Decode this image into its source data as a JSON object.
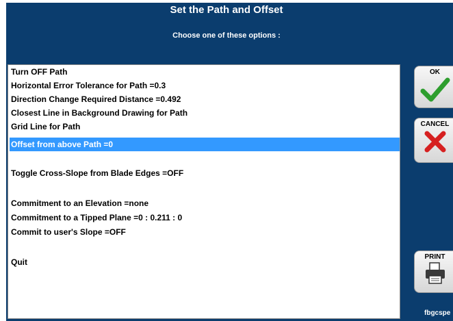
{
  "dialog": {
    "title": "Set the Path and Offset",
    "subtitle": "Choose one of these options :"
  },
  "options": [
    "Turn OFF Path",
    "Horizontal Error Tolerance for Path  =0.3",
    "Direction Change Required Distance  =0.492",
    "Closest Line in Background Drawing for Path",
    "Grid Line for Path",
    "Offset from above Path  =0",
    "Toggle Cross-Slope from Blade Edges   =OFF",
    "Commitment to an Elevation   =none",
    "Commitment to a Tipped Plane =0 : 0.211 : 0",
    "Commit to user's Slope  =OFF",
    "Quit"
  ],
  "selected_option": "Offset from above Path  =0",
  "buttons": {
    "ok_label": "OK",
    "cancel_label": "CANCEL",
    "print_label": "PRINT"
  },
  "icons": {
    "ok": "checkmark-icon",
    "cancel": "x-icon",
    "print": "printer-icon"
  },
  "footer": {
    "text": "fbgcspe"
  },
  "colors": {
    "background": "#0b3d6e",
    "selection": "#3399ff",
    "ok_check": "#2e9e2e",
    "cancel_x": "#d62020"
  }
}
